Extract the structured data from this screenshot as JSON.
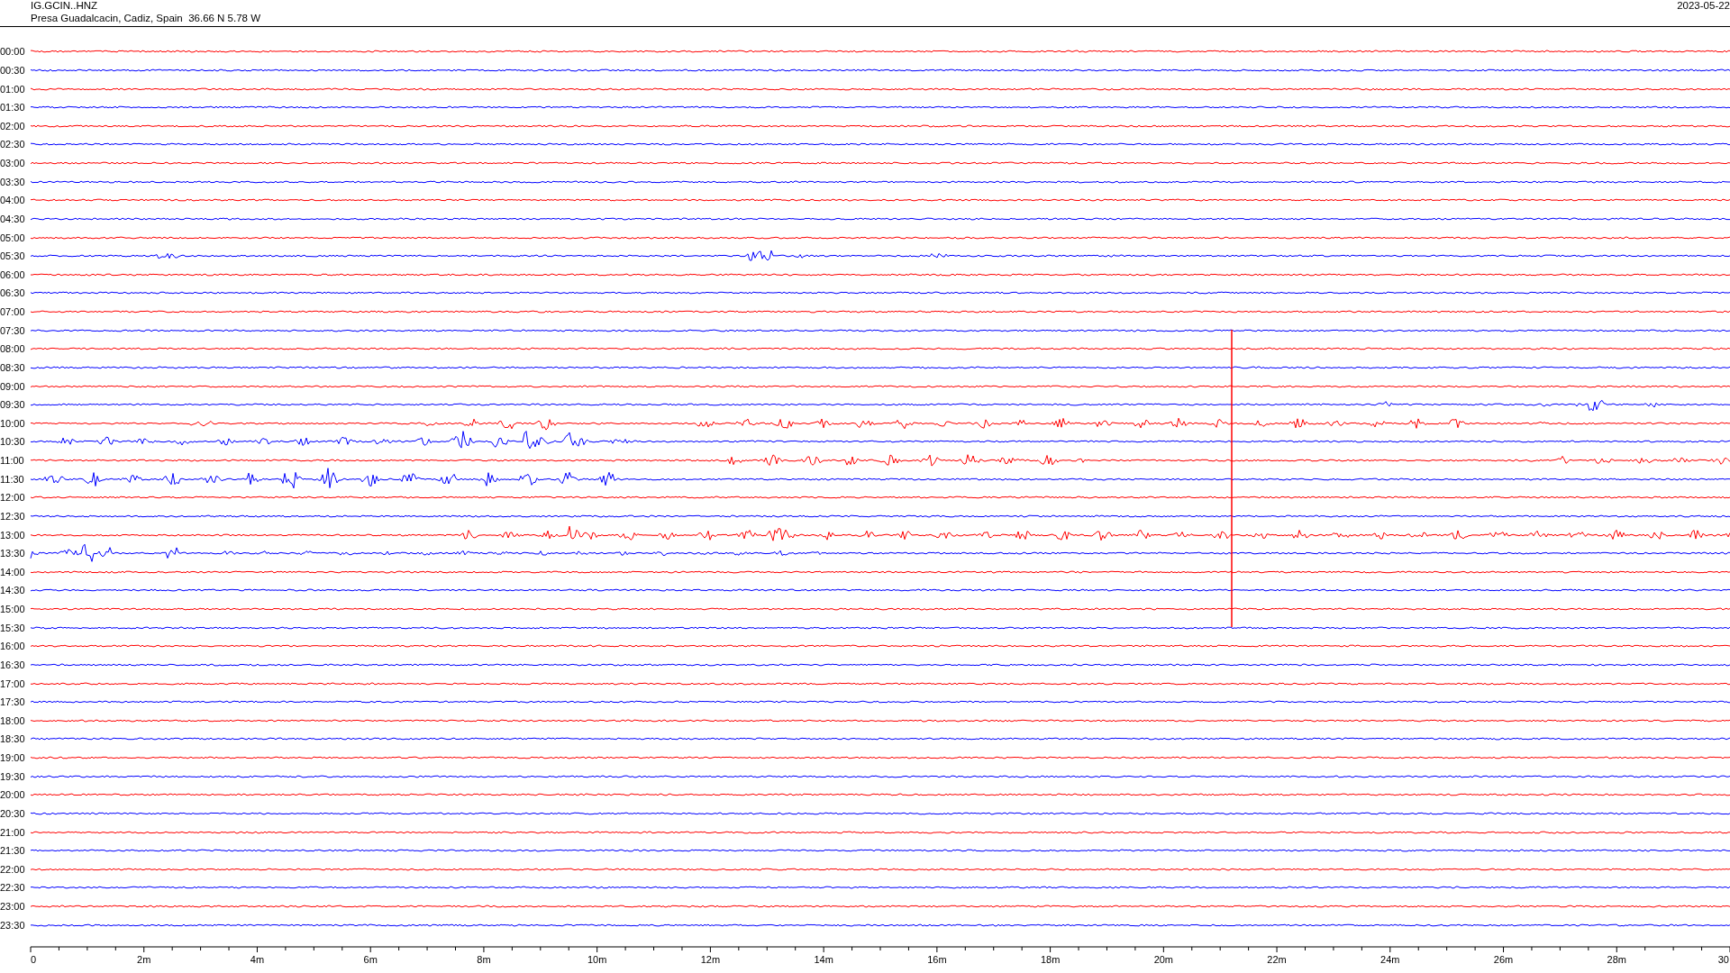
{
  "header": {
    "station": "IG.GCIN..HNZ",
    "location": "Presa Guadalcacin, Cadiz, Spain  36.66 N 5.78 W",
    "date": "2023-05-22"
  },
  "rows": [
    {
      "time": "00:00",
      "color": "#ff0000"
    },
    {
      "time": "00:30",
      "color": "#0000ff"
    },
    {
      "time": "01:00",
      "color": "#ff0000"
    },
    {
      "time": "01:30",
      "color": "#0000ff"
    },
    {
      "time": "02:00",
      "color": "#ff0000"
    },
    {
      "time": "02:30",
      "color": "#0000ff"
    },
    {
      "time": "03:00",
      "color": "#ff0000"
    },
    {
      "time": "03:30",
      "color": "#0000ff"
    },
    {
      "time": "04:00",
      "color": "#ff0000"
    },
    {
      "time": "04:30",
      "color": "#0000ff"
    },
    {
      "time": "05:00",
      "color": "#ff0000"
    },
    {
      "time": "05:30",
      "color": "#0000ff"
    },
    {
      "time": "06:00",
      "color": "#ff0000"
    },
    {
      "time": "06:30",
      "color": "#0000ff"
    },
    {
      "time": "07:00",
      "color": "#ff0000"
    },
    {
      "time": "07:30",
      "color": "#0000ff"
    },
    {
      "time": "08:00",
      "color": "#ff0000"
    },
    {
      "time": "08:30",
      "color": "#0000ff"
    },
    {
      "time": "09:00",
      "color": "#ff0000"
    },
    {
      "time": "09:30",
      "color": "#0000ff"
    },
    {
      "time": "10:00",
      "color": "#ff0000"
    },
    {
      "time": "10:30",
      "color": "#0000ff"
    },
    {
      "time": "11:00",
      "color": "#ff0000"
    },
    {
      "time": "11:30",
      "color": "#0000ff"
    },
    {
      "time": "12:00",
      "color": "#ff0000"
    },
    {
      "time": "12:30",
      "color": "#0000ff"
    },
    {
      "time": "13:00",
      "color": "#ff0000"
    },
    {
      "time": "13:30",
      "color": "#0000ff"
    },
    {
      "time": "14:00",
      "color": "#ff0000"
    },
    {
      "time": "14:30",
      "color": "#0000ff"
    },
    {
      "time": "15:00",
      "color": "#ff0000"
    },
    {
      "time": "15:30",
      "color": "#0000ff"
    },
    {
      "time": "16:00",
      "color": "#ff0000"
    },
    {
      "time": "16:30",
      "color": "#0000ff"
    },
    {
      "time": "17:00",
      "color": "#ff0000"
    },
    {
      "time": "17:30",
      "color": "#0000ff"
    },
    {
      "time": "18:00",
      "color": "#ff0000"
    },
    {
      "time": "18:30",
      "color": "#0000ff"
    },
    {
      "time": "19:00",
      "color": "#ff0000"
    },
    {
      "time": "19:30",
      "color": "#0000ff"
    },
    {
      "time": "20:00",
      "color": "#ff0000"
    },
    {
      "time": "20:30",
      "color": "#0000ff"
    },
    {
      "time": "21:00",
      "color": "#ff0000"
    },
    {
      "time": "21:30",
      "color": "#0000ff"
    },
    {
      "time": "22:00",
      "color": "#ff0000"
    },
    {
      "time": "22:30",
      "color": "#0000ff"
    },
    {
      "time": "23:00",
      "color": "#ff0000"
    },
    {
      "time": "23:30",
      "color": "#0000ff"
    }
  ],
  "axis": {
    "labels": [
      "0",
      "2m",
      "4m",
      "6m",
      "8m",
      "10m",
      "12m",
      "14m",
      "16m",
      "18m",
      "20m",
      "22m",
      "24m",
      "26m",
      "28m",
      "30"
    ]
  }
}
